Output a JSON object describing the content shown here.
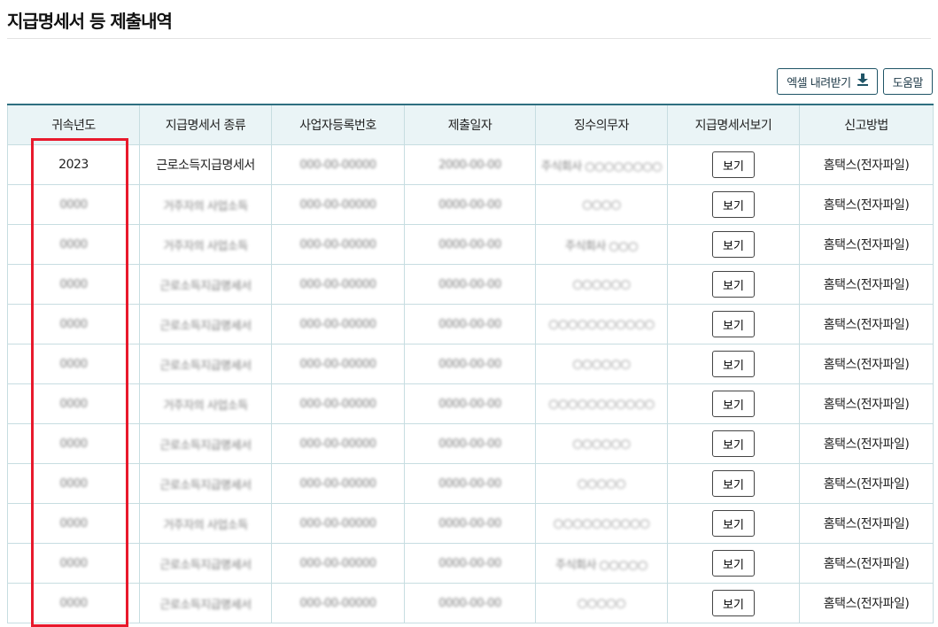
{
  "page": {
    "title": "지급명세서 등 제출내역"
  },
  "toolbar": {
    "excel_label": "엑셀 내려받기",
    "help_label": "도움말"
  },
  "table": {
    "headers": [
      "귀속년도",
      "지급명세서 종류",
      "사업자등록번호",
      "제출일자",
      "징수의무자",
      "지급명세서보기",
      "신고방법"
    ],
    "rows": [
      {
        "year": "2023",
        "type": "근로소득지급명세서",
        "bizno": "000-00-00000",
        "date": "2000-00-00",
        "payer": "주식회사 ○○○○○○○○",
        "view": "보기",
        "method": "홈택스(전자파일)"
      },
      {
        "year": "0000",
        "type": "거주자의 사업소득",
        "bizno": "000-00-00000",
        "date": "0000-00-00",
        "payer": "○○○○",
        "view": "보기",
        "method": "홈택스(전자파일)"
      },
      {
        "year": "0000",
        "type": "거주자의 사업소득",
        "bizno": "000-00-00000",
        "date": "0000-00-00",
        "payer": "주식회사 ○○○",
        "view": "보기",
        "method": "홈택스(전자파일)"
      },
      {
        "year": "0000",
        "type": "근로소득지급명세서",
        "bizno": "000-00-00000",
        "date": "0000-00-00",
        "payer": "○○○○○○",
        "view": "보기",
        "method": "홈택스(전자파일)"
      },
      {
        "year": "0000",
        "type": "근로소득지급명세서",
        "bizno": "000-00-00000",
        "date": "0000-00-00",
        "payer": "○○○○○○○○○○○",
        "view": "보기",
        "method": "홈택스(전자파일)"
      },
      {
        "year": "0000",
        "type": "근로소득지급명세서",
        "bizno": "000-00-00000",
        "date": "0000-00-00",
        "payer": "○○○○○○",
        "view": "보기",
        "method": "홈택스(전자파일)"
      },
      {
        "year": "0000",
        "type": "거주자의 사업소득",
        "bizno": "000-00-00000",
        "date": "0000-00-00",
        "payer": "○○○○○○○○○○○",
        "view": "보기",
        "method": "홈택스(전자파일)"
      },
      {
        "year": "0000",
        "type": "근로소득지급명세서",
        "bizno": "000-00-00000",
        "date": "0000-00-00",
        "payer": "○○○○○○",
        "view": "보기",
        "method": "홈택스(전자파일)"
      },
      {
        "year": "0000",
        "type": "근로소득지급명세서",
        "bizno": "000-00-00000",
        "date": "0000-00-00",
        "payer": "○○○○○",
        "view": "보기",
        "method": "홈택스(전자파일)"
      },
      {
        "year": "0000",
        "type": "거주자의 사업소득",
        "bizno": "000-00-00000",
        "date": "0000-00-00",
        "payer": "○○○○○○○○○○",
        "view": "보기",
        "method": "홈택스(전자파일)"
      },
      {
        "year": "0000",
        "type": "근로소득지급명세서",
        "bizno": "000-00-00000",
        "date": "0000-00-00",
        "payer": "주식회사 ○○○○○",
        "view": "보기",
        "method": "홈택스(전자파일)"
      },
      {
        "year": "0000",
        "type": "근로소득지급명세서",
        "bizno": "000-00-00000",
        "date": "0000-00-00",
        "payer": "○○○○○",
        "view": "보기",
        "method": "홈택스(전자파일)"
      }
    ]
  },
  "icons": {
    "download": "download-icon"
  },
  "colors": {
    "header_bg": "#eaf4f6",
    "border": "#c7dde1",
    "highlight": "#e8192c",
    "accent": "#1f5466"
  }
}
